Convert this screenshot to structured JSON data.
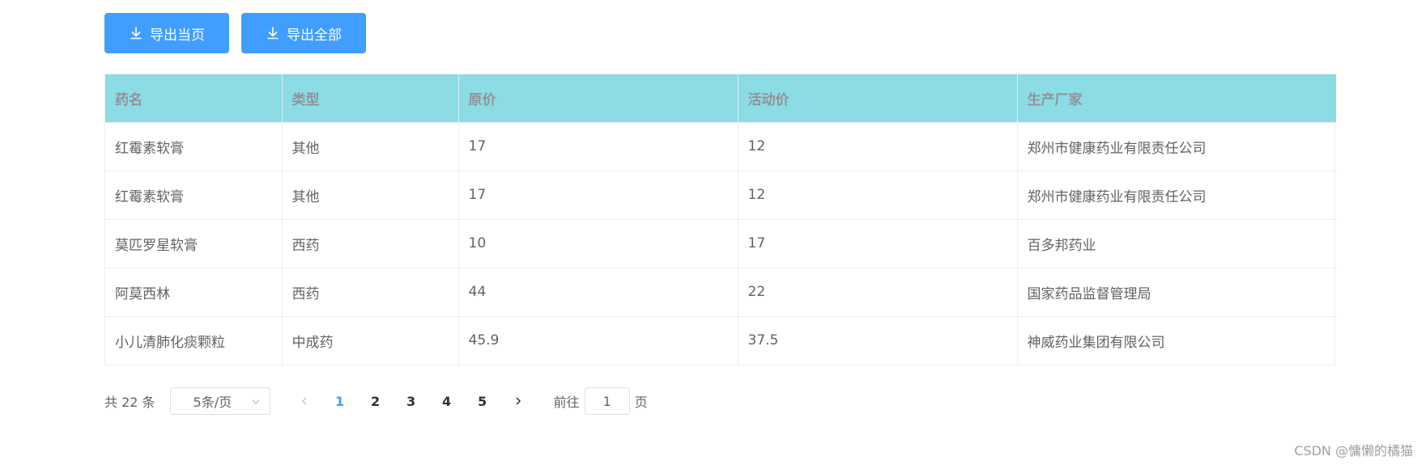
{
  "toolbar": {
    "export_current_label": "导出当页",
    "export_all_label": "导出全部",
    "download_icon": "download-icon"
  },
  "table": {
    "headers": [
      "药名",
      "类型",
      "原价",
      "活动价",
      "生产厂家"
    ],
    "rows": [
      [
        "红霉素软膏",
        "其他",
        "17",
        "12",
        "郑州市健康药业有限责任公司"
      ],
      [
        "红霉素软膏",
        "其他",
        "17",
        "12",
        "郑州市健康药业有限责任公司"
      ],
      [
        "莫匹罗星软膏",
        "西药",
        "10",
        "17",
        "百多邦药业"
      ],
      [
        "阿莫西林",
        "西药",
        "44",
        "22",
        "国家药品监督管理局"
      ],
      [
        "小儿清肺化痰颗粒",
        "中成药",
        "45.9",
        "37.5",
        "神威药业集团有限公司"
      ]
    ],
    "header_bg": "#8bdce4"
  },
  "pagination": {
    "total_label": "共 22 条",
    "page_size_label": "5条/页",
    "pages": [
      "1",
      "2",
      "3",
      "4",
      "5"
    ],
    "current_page": "1",
    "goto_prefix": "前往",
    "goto_value": "1",
    "goto_suffix": "页"
  },
  "watermark": "CSDN @慵懒的橘猫",
  "colors": {
    "primary": "#409eff",
    "text": "#606266"
  }
}
